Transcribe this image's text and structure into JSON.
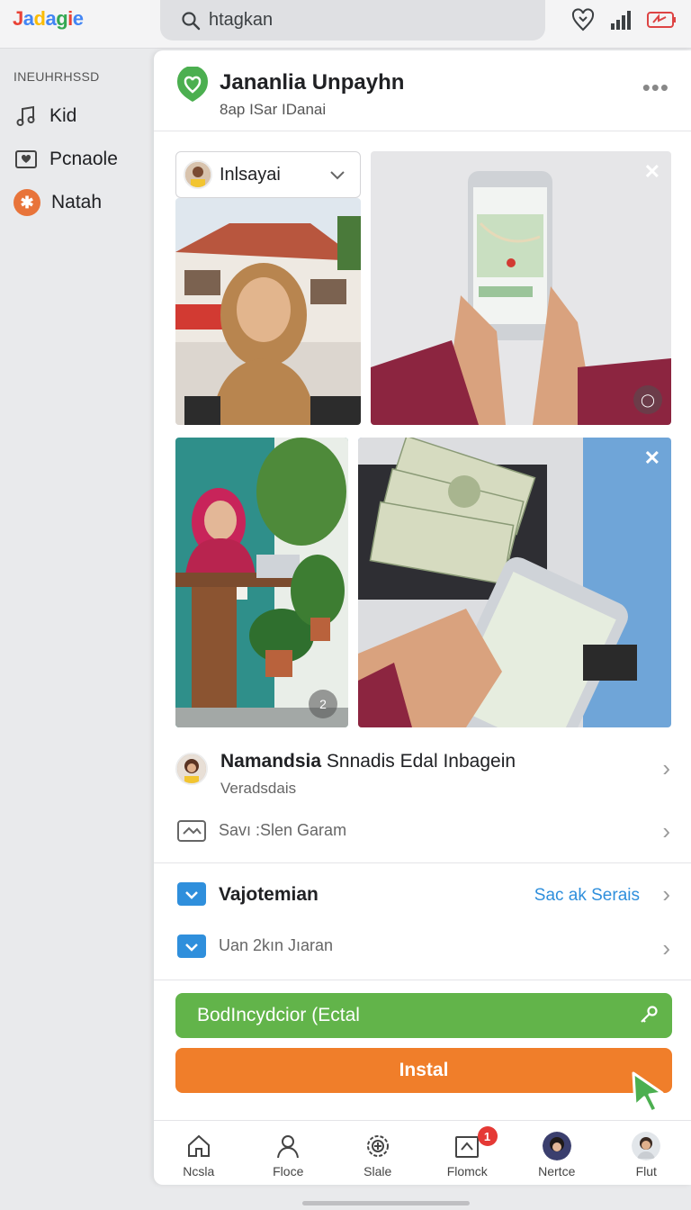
{
  "topbar": {
    "logo_letters": [
      "J",
      "a",
      "d",
      "a",
      "g",
      "i",
      "e"
    ],
    "logo_colors": [
      "#e94235",
      "#4285f4",
      "#fbbc05",
      "#4285f4",
      "#34a853",
      "#ea4335",
      "#4285f4"
    ],
    "search_text": "htagkan",
    "icons": [
      "heart-location-icon",
      "signal-icon",
      "battery-icon"
    ]
  },
  "sidebar": {
    "heading": "INEUHRHSSD",
    "items": [
      {
        "label": "Kid",
        "icon": "music-note-icon"
      },
      {
        "label": "Pcnaole",
        "icon": "heart-card-icon"
      },
      {
        "label": "Natah",
        "icon": "star-badge-icon"
      }
    ]
  },
  "app": {
    "title": "Jananlia Unpayhn",
    "subtitle": "8ap ISar IDanai",
    "more_label": "•••",
    "accent_green": "#62b44a",
    "accent_orange": "#f07e2a",
    "accent_blue": "#2f8fdc"
  },
  "gallery": {
    "selector_label": "Inlsayai",
    "tiles": [
      {
        "name": "photo-woman-house"
      },
      {
        "name": "photo-phone-map",
        "closable": true
      },
      {
        "name": "photo-woman-desk",
        "counter": "2"
      },
      {
        "name": "photo-money-phone",
        "closable": true
      }
    ]
  },
  "list": {
    "item1": {
      "title_bold": "Namandsia",
      "title_rest": " Snnadis Edal Inbagein",
      "sub": "Veradsdais"
    },
    "item2": {
      "label": "Savı :Slen Garam"
    },
    "item3": {
      "title": "Vajotemian",
      "link": "Sac ak Serais"
    },
    "item4": {
      "label": "Uan 2kın Jıaran"
    }
  },
  "buttons": {
    "green": "BodIncydcior (Ectal",
    "orange": "Instal"
  },
  "bottom_nav": [
    {
      "label": "Ncsla",
      "icon": "home-icon"
    },
    {
      "label": "Floce",
      "icon": "person-icon"
    },
    {
      "label": "Slale",
      "icon": "settings-icon"
    },
    {
      "label": "Flomck",
      "icon": "inbox-icon",
      "badge": "1"
    },
    {
      "label": "Nertce",
      "icon": "avatar"
    },
    {
      "label": "Flut",
      "icon": "avatar"
    }
  ]
}
